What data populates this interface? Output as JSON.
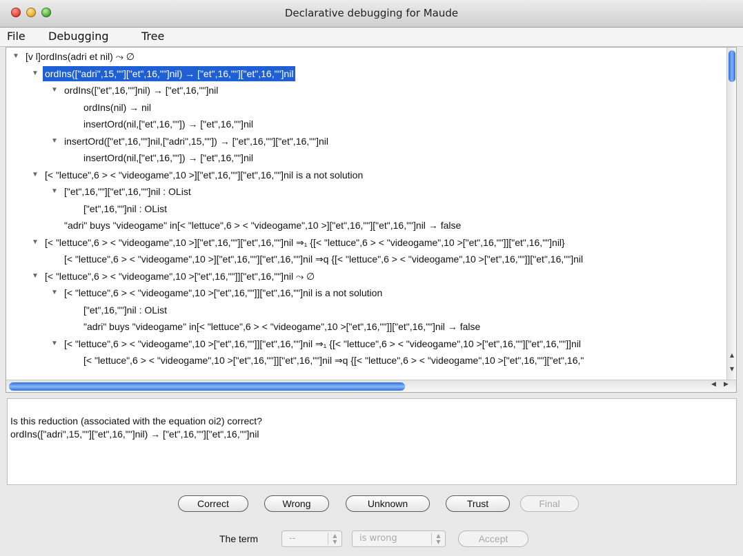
{
  "window": {
    "title": "Declarative debugging for Maude"
  },
  "menubar": {
    "items": [
      "File",
      "Debugging",
      "Tree"
    ]
  },
  "tree": {
    "rows": [
      {
        "text": "[v l]ordIns(adri et nil) ⤳ ∅",
        "indent": 0,
        "expander": "▼",
        "selected": false
      },
      {
        "text": "ordIns([\"adri\",15,\"\"][\"et\",16,\"\"]nil) → [\"et\",16,\"\"][\"et\",16,\"\"]nil",
        "indent": 1,
        "expander": "▼",
        "selected": true
      },
      {
        "text": "ordIns([\"et\",16,\"\"]nil) → [\"et\",16,\"\"]nil",
        "indent": 2,
        "expander": "▼",
        "selected": false
      },
      {
        "text": "ordIns(nil) → nil",
        "indent": 3,
        "expander": "",
        "selected": false
      },
      {
        "text": "insertOrd(nil,[\"et\",16,\"\"]) → [\"et\",16,\"\"]nil",
        "indent": 3,
        "expander": "",
        "selected": false
      },
      {
        "text": "insertOrd([\"et\",16,\"\"]nil,[\"adri\",15,\"\"]) → [\"et\",16,\"\"][\"et\",16,\"\"]nil",
        "indent": 2,
        "expander": "▼",
        "selected": false
      },
      {
        "text": "insertOrd(nil,[\"et\",16,\"\"]) → [\"et\",16,\"\"]nil",
        "indent": 3,
        "expander": "",
        "selected": false
      },
      {
        "text": "[< \"lettuce\",6 > < \"videogame\",10 >][\"et\",16,\"\"][\"et\",16,\"\"]nil is a not solution",
        "indent": 1,
        "expander": "▼",
        "selected": false
      },
      {
        "text": "[\"et\",16,\"\"][\"et\",16,\"\"]nil : OList",
        "indent": 2,
        "expander": "▼",
        "selected": false
      },
      {
        "text": "[\"et\",16,\"\"]nil : OList",
        "indent": 3,
        "expander": "",
        "selected": false
      },
      {
        "text": "\"adri\" buys \"videogame\" in[< \"lettuce\",6 > < \"videogame\",10 >][\"et\",16,\"\"][\"et\",16,\"\"]nil → false",
        "indent": 2,
        "expander": "",
        "selected": false
      },
      {
        "text": "[< \"lettuce\",6 > < \"videogame\",10 >][\"et\",16,\"\"][\"et\",16,\"\"]nil ⇒₁ {[< \"lettuce\",6 > < \"videogame\",10 >[\"et\",16,\"\"]][\"et\",16,\"\"]nil}",
        "indent": 1,
        "expander": "▼",
        "selected": false
      },
      {
        "text": "[< \"lettuce\",6 > < \"videogame\",10 >][\"et\",16,\"\"][\"et\",16,\"\"]nil ⇒q {[< \"lettuce\",6 > < \"videogame\",10 >[\"et\",16,\"\"]][\"et\",16,\"\"]nil",
        "indent": 2,
        "expander": "",
        "selected": false
      },
      {
        "text": "[< \"lettuce\",6 > < \"videogame\",10 >[\"et\",16,\"\"]][\"et\",16,\"\"]nil ⤳ ∅",
        "indent": 1,
        "expander": "▼",
        "selected": false
      },
      {
        "text": "[< \"lettuce\",6 > < \"videogame\",10 >[\"et\",16,\"\"]][\"et\",16,\"\"]nil is a not solution",
        "indent": 2,
        "expander": "▼",
        "selected": false
      },
      {
        "text": "[\"et\",16,\"\"]nil : OList",
        "indent": 3,
        "expander": "",
        "selected": false
      },
      {
        "text": "\"adri\" buys \"videogame\" in[< \"lettuce\",6 > < \"videogame\",10 >[\"et\",16,\"\"]][\"et\",16,\"\"]nil → false",
        "indent": 3,
        "expander": "",
        "selected": false
      },
      {
        "text": "[< \"lettuce\",6 > < \"videogame\",10 >[\"et\",16,\"\"]][\"et\",16,\"\"]nil ⇒₁ {[< \"lettuce\",6 > < \"videogame\",10 >[\"et\",16,\"\"][\"et\",16,\"\"]]nil",
        "indent": 2,
        "expander": "▼",
        "selected": false
      },
      {
        "text": "[< \"lettuce\",6 > < \"videogame\",10 >[\"et\",16,\"\"]][\"et\",16,\"\"]nil ⇒q {[< \"lettuce\",6 > < \"videogame\",10 >[\"et\",16,\"\"][\"et\",16,\"",
        "indent": 3,
        "expander": "",
        "selected": false
      }
    ]
  },
  "question": {
    "line1": "Is this reduction (associated with the equation oi2) correct?",
    "line2": "ordIns([\"adri\",15,\"\"][\"et\",16,\"\"]nil) → [\"et\",16,\"\"][\"et\",16,\"\"]nil"
  },
  "buttons": {
    "correct": "Correct",
    "wrong": "Wrong",
    "unknown": "Unknown",
    "trust": "Trust",
    "final": "Final"
  },
  "term_row": {
    "label": "The term",
    "term_select": "--",
    "status_select": "is wrong",
    "accept": "Accept"
  },
  "colors": {
    "selection": "#1f5fd6",
    "scroll_thumb": "#2d6de0"
  }
}
